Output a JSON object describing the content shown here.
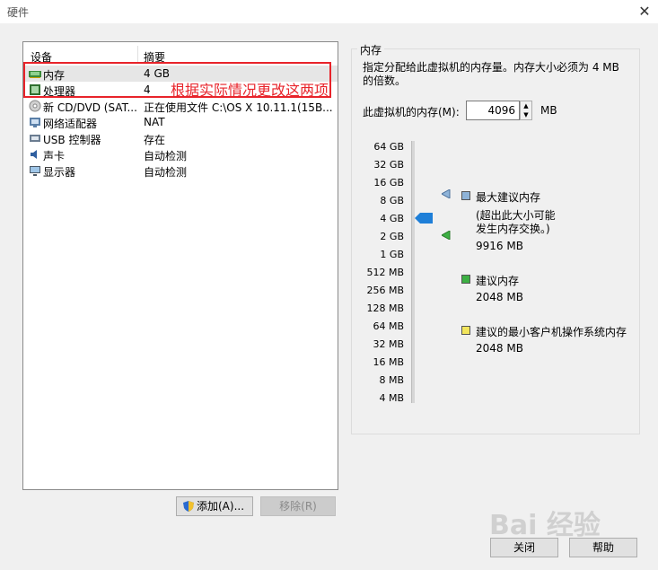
{
  "window": {
    "title": "硬件"
  },
  "list": {
    "headers": {
      "device": "设备",
      "summary": "摘要"
    },
    "rows": [
      {
        "name": "内存",
        "summary": "4 GB",
        "icon": "memory-icon"
      },
      {
        "name": "处理器",
        "summary": "4",
        "icon": "processor-icon"
      },
      {
        "name": "新 CD/DVD (SAT...",
        "summary": "正在使用文件 C:\\OS X 10.11.1(15B...",
        "icon": "cd-dvd-icon"
      },
      {
        "name": "网络适配器",
        "summary": "NAT",
        "icon": "network-adapter-icon"
      },
      {
        "name": "USB 控制器",
        "summary": "存在",
        "icon": "usb-icon"
      },
      {
        "name": "声卡",
        "summary": "自动检测",
        "icon": "sound-card-icon"
      },
      {
        "name": "显示器",
        "summary": "自动检测",
        "icon": "display-icon"
      }
    ]
  },
  "annotation": {
    "text": "根据实际情况更改这两项",
    "color": "#e8232a"
  },
  "buttons": {
    "add": "添加(A)...",
    "remove": "移除(R)",
    "close": "关闭",
    "help": "帮助"
  },
  "memory": {
    "group_label": "内存",
    "description": "指定分配给此虚拟机的内存量。内存大小必须为 4 MB 的倍数。",
    "field_label": "此虚拟机的内存(M):",
    "value": "4096",
    "unit": "MB",
    "scale": [
      "64 GB",
      "32 GB",
      "16 GB",
      "8 GB",
      "4 GB",
      "2 GB",
      "1 GB",
      "512 MB",
      "256 MB",
      "128 MB",
      "64 MB",
      "32 MB",
      "16 MB",
      "8 MB",
      "4 MB"
    ],
    "legend": {
      "max_label": "最大建议内存",
      "max_note": "(超出此大小可能\n发生内存交换。)",
      "max_value": "9916 MB",
      "rec_label": "建议内存",
      "rec_value": "2048 MB",
      "min_label": "建议的最小客户机操作系统内存",
      "min_value": "2048 MB"
    },
    "colors": {
      "max": "#8fb4d9",
      "rec": "#3cb043",
      "min": "#f2e55c",
      "thumb": "#1e7fd8"
    }
  },
  "watermark": "Bai 经验"
}
